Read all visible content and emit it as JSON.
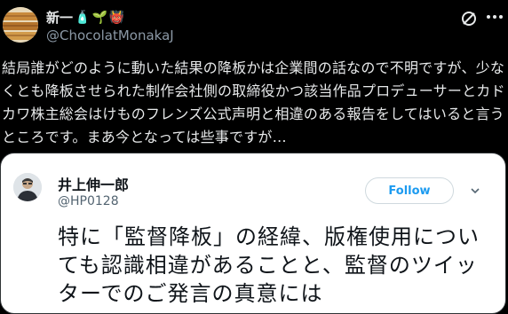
{
  "tweet": {
    "display_name": "新一",
    "name_emojis": [
      "🧴",
      "🌱",
      "👹"
    ],
    "handle": "@ChocolatMonakaJ",
    "text": "結局誰がどのように動いた結果の降板かは企業間の話なので不明ですが、少なくとも降板させられた制作会社側の取締役かつ該当作品プロデューサーとカドカワ株主総会はけものフレンズ公式声明と相違のある報告をしてはいると言うところです。まあ今となっては些事ですが…"
  },
  "quoted": {
    "name": "井上伸一郎",
    "handle": "@HP0128",
    "follow_label": "Follow",
    "text": "特に「監督降板」の経緯、版権使用についても認識相違があることと、監督のツイッターでのご発言の真意には"
  },
  "colors": {
    "background": "#000000",
    "text_primary": "#e7e9ea",
    "text_secondary": "#8b98a5",
    "accent": "#1d9bf0"
  }
}
